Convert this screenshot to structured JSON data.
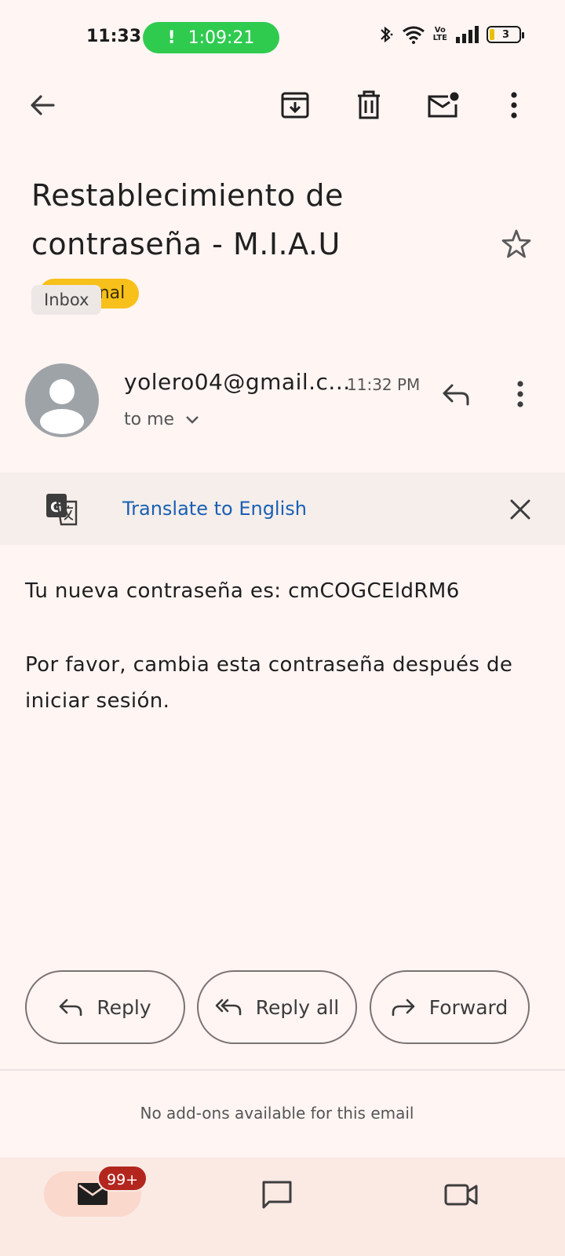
{
  "status_bar": {
    "time": "11:33",
    "call_indicator": "!",
    "call_timer": "1:09:21",
    "network_label_top": "Vo",
    "network_label_bottom": "LTE",
    "battery_level": "3"
  },
  "toolbar": {
    "icons": [
      "back-arrow-icon",
      "archive-icon",
      "delete-icon",
      "mark-unread-icon",
      "more-vert-icon"
    ]
  },
  "email": {
    "subject": "Restablecimiento de contraseña - M.I.A.U",
    "external_badge": "External",
    "label_chip": "Inbox",
    "sender": "yolero04@gmail.c...",
    "time": "11:32 PM",
    "recipient": "to me",
    "translate_link": "Translate to English",
    "body_line1": "Tu nueva contraseña es: cmCOGCEldRM6",
    "body_line2": "Por favor, cambia esta contraseña después de iniciar sesión."
  },
  "actions": {
    "reply": "Reply",
    "reply_all": "Reply all",
    "forward": "Forward"
  },
  "addons_text": "No add-ons available for this email",
  "bottom_nav": {
    "mail_badge": "99+",
    "items": [
      "mail-icon",
      "chat-icon",
      "meet-video-icon"
    ]
  },
  "colors": {
    "background": "#fff5f3",
    "external_badge": "#f8c01b",
    "call_pill": "#2fcb4f",
    "link": "#1a5fb4",
    "badge": "#b3261e"
  }
}
